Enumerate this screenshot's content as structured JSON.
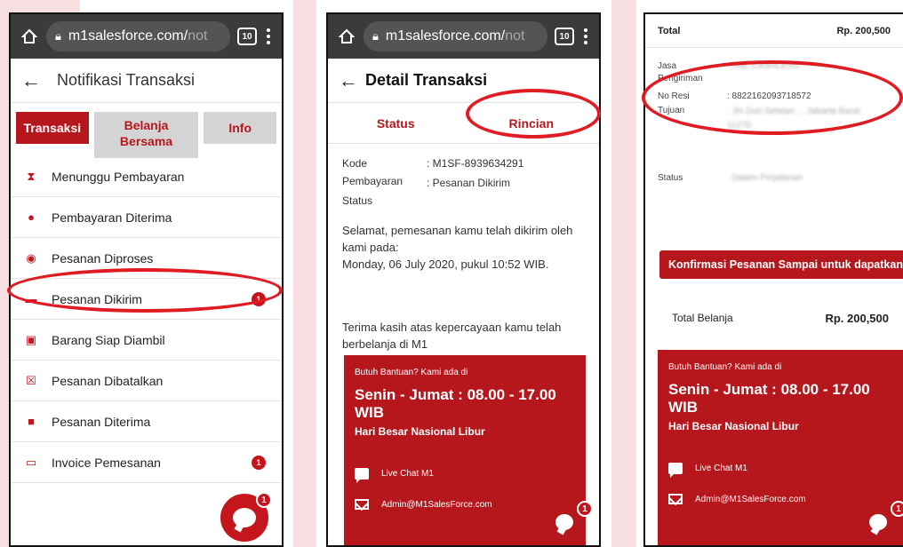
{
  "browser": {
    "url": "m1salesforce.com/not",
    "url_main": "m1salesforce.com/",
    "url_dim": "not",
    "tab_count": "10"
  },
  "screen1": {
    "title": "Notifikasi Transaksi",
    "tabs": [
      {
        "label": "Transaksi",
        "active": true
      },
      {
        "label": "Belanja Bersama",
        "active": false
      },
      {
        "label": "Info",
        "active": false
      }
    ],
    "menu": [
      {
        "label": "Menunggu Pembayaran",
        "icon": "hourglass-icon",
        "badge": ""
      },
      {
        "label": "Pembayaran Diterima",
        "icon": "money-bag-icon",
        "badge": ""
      },
      {
        "label": "Pesanan Diproses",
        "icon": "process-icon",
        "badge": ""
      },
      {
        "label": "Pesanan Dikirim",
        "icon": "truck-icon",
        "badge": "1"
      },
      {
        "label": "Barang Siap Diambil",
        "icon": "box-icon",
        "badge": ""
      },
      {
        "label": "Pesanan Dibatalkan",
        "icon": "cancel-clipboard-icon",
        "badge": ""
      },
      {
        "label": "Pesanan Diterima",
        "icon": "received-icon",
        "badge": ""
      },
      {
        "label": "Invoice Pemesanan",
        "icon": "invoice-icon",
        "badge": "1"
      }
    ],
    "chat_badge": "1"
  },
  "screen2": {
    "title": "Detail Transaksi",
    "tabs": [
      "Status",
      "Rincian"
    ],
    "kode_label": "Kode Pembayaran",
    "kode_value": ": M1SF-8939634291",
    "status_label": "Status",
    "status_value": ": Pesanan Dikirim",
    "message_line1": "Selamat, pemesanan kamu telah dikirim oleh kami pada:",
    "message_date": "Monday, 06 July 2020, pukul 10:52 WIB.",
    "thanks": "Terima kasih atas kepercayaan kamu telah berbelanja di M1",
    "help": {
      "intro": "Butuh Bantuan? Kami ada di",
      "hours": "Senin - Jumat : 08.00 - 17.00 WIB",
      "holiday": "Hari Besar Nasional Libur",
      "live_chat": "Live Chat M1",
      "email": "Admin@M1SalesForce.com"
    },
    "chat_badge": "1"
  },
  "screen3": {
    "total_label": "Total",
    "total_value": "Rp. 200,500",
    "jasa_label": "Jasa Pengiriman",
    "jasa_value": ": JNE CASHLESS",
    "resi_label": "No Resi",
    "resi_value": ": 8822162093718572",
    "tujuan_label": "Tujuan",
    "tujuan_value": ": Jln Duri Selatan ... Jakarta Barat 11270",
    "status_label": "Status",
    "status_value": ": Dalam Perjalanan",
    "confirm_button": "Konfirmasi Pesanan Sampai untuk dapatkan P",
    "total_belanja_label": "Total Belanja",
    "total_belanja_value": "Rp. 200,500",
    "help": {
      "intro": "Butuh Bantuan? Kami ada di",
      "hours": "Senin - Jumat : 08.00 - 17.00 WIB",
      "holiday": "Hari Besar Nasional Libur",
      "live_chat": "Live Chat M1",
      "email": "Admin@M1SalesForce.com"
    },
    "chat_badge": "1"
  },
  "colors": {
    "brand_red": "#b5171d",
    "annotation_red": "#e01b22",
    "chrome_bar": "#3a3b3c"
  }
}
